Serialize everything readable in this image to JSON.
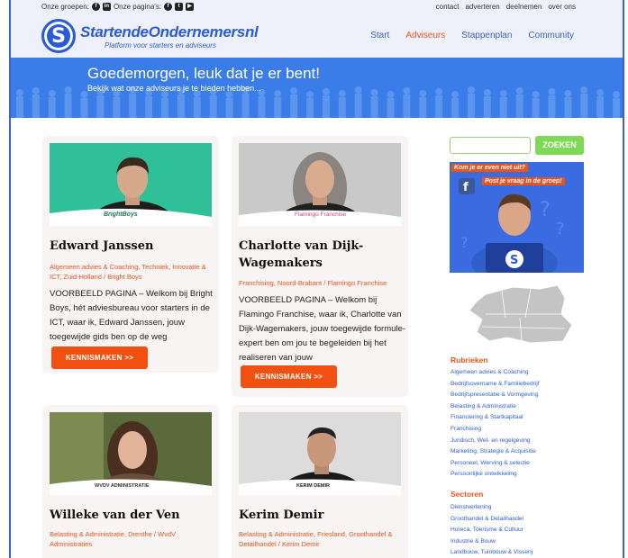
{
  "topbar": {
    "groups_label": "Onze groepen:",
    "pages_label": "Onze pagina's:",
    "links": [
      "contact",
      "adverteren",
      "deelnemen",
      "over ons"
    ]
  },
  "brand": {
    "logo_letter": "S",
    "name": "StartendeOndernemersnl",
    "tagline": "Platform voor starters en adviseurs"
  },
  "nav": [
    {
      "label": "Start",
      "active": false
    },
    {
      "label": "Adviseurs",
      "active": true
    },
    {
      "label": "Stappenplan",
      "active": false
    },
    {
      "label": "Community",
      "active": false
    }
  ],
  "hero": {
    "title": "Goedemorgen, leuk dat je er bent!",
    "subtitle": "Bekijk wat onze adviseurs je te bieden hebben..."
  },
  "cards": [
    {
      "name": "Edward Janssen",
      "brand": "BrightBoys",
      "tags": "Algemeen advies & Coaching, Techniek, Innovatie & ICT, Zuid-Holland / Bright Boys",
      "desc": "VOORBEELD PAGINA – Welkom bij Bright Boys, hét adviesbureau voor starters in de ICT, waar ik, Edward Janssen, jouw toegewijde gids ben op de weg",
      "button": "KENNISMAKEN >>"
    },
    {
      "name": "Charlotte van Dijk-Wagemakers",
      "brand": "Flamingo Franchise",
      "tags": "Franchising, Noord-Brabant / Flamingo Franchise",
      "desc": "VOORBEELD PAGINA – Welkom bij Flamingo Franchise, waar ik, Charlotte van Dijk-Wagemakers, jouw toegewijde formule-expert ben om jou te begeleiden bij het realiseren van jouw",
      "button": "KENNISMAKEN >>"
    },
    {
      "name": "Willeke van der Ven",
      "brand": "WVDV ADMINISTRATIE",
      "tags": "Belasting & Administratie, Drenthe / WvdV Administraties"
    },
    {
      "name": "Kerim Demir",
      "brand": "KERIM DEMIR",
      "tags": "Belasting & Administratie, Friesland, Groothandel & Detailhandel / Kerim Demir"
    }
  ],
  "sidebar": {
    "search_placeholder": "",
    "search_button": "ZOEKEN",
    "promo_line1": "Kom je er even niet uit?",
    "promo_line2": "Post je vraag in de groep!",
    "rubrieken_title": "Rubrieken",
    "rubrieken": [
      "Algemeen advies & Coaching",
      "Bedrijfsovername & Familiebedrijf",
      "Bedrijfspresentatie & Vormgeving",
      "Belasting & Administratie",
      "Financiering & Startkapitaal",
      "Franchising",
      "Juridisch, Wet- en regelgeving",
      "Marketing, Strategie & Acquisitie",
      "Personeel, Werving & selectie",
      "Persoonlijke ontwikkeling"
    ],
    "sectoren_title": "Sectoren",
    "sectoren": [
      "Dienstverlening",
      "Groothandel & Detailhandel",
      "Horeca, Toerisme & Cultuur",
      "Industrie & Bouw",
      "Landbouw, Tuinbouw & Visserij"
    ]
  },
  "colors": {
    "brand_blue": "#2a5bd7",
    "hero_blue": "#3b7de8",
    "accent_orange": "#f25011",
    "search_green": "#7ed957"
  }
}
